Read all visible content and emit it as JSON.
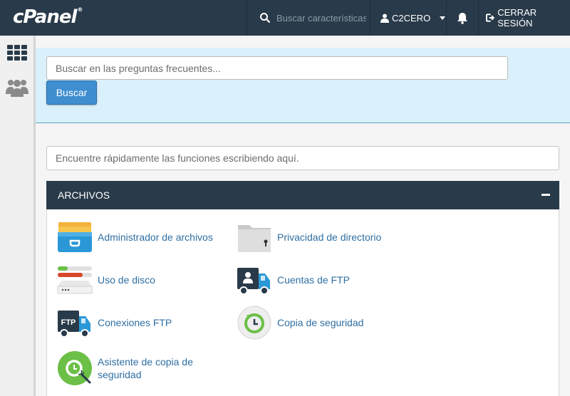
{
  "topbar": {
    "logo": "cPanel",
    "logo_mark": "®",
    "search_placeholder": "Buscar características",
    "user": "C2CERO",
    "logout": "CERRAR SESIÓN"
  },
  "faq": {
    "placeholder": "Buscar en las preguntas frecuentes...",
    "button": "Buscar"
  },
  "quick_find": {
    "placeholder": "Encuentre rápidamente las funciones escribiendo aquí."
  },
  "files_panel": {
    "title": "ARCHIVOS",
    "items": [
      {
        "label": "Administrador de archivos",
        "icon": "file-manager-icon"
      },
      {
        "label": "Privacidad de directorio",
        "icon": "directory-privacy-icon"
      },
      {
        "label": "Uso de disco",
        "icon": "disk-usage-icon"
      },
      {
        "label": "Cuentas de FTP",
        "icon": "ftp-accounts-icon"
      },
      {
        "label": "Conexiones FTP",
        "icon": "ftp-connections-icon"
      },
      {
        "label": "Copia de seguridad",
        "icon": "backup-icon"
      },
      {
        "label": "Asistente de copia de seguridad",
        "icon": "backup-wizard-icon"
      }
    ],
    "ftp_badge": "FTP"
  },
  "colors": {
    "topbar": "#293a4a",
    "link": "#2f6fa3",
    "button": "#3f8ed0",
    "faq_band": "#daf0fa"
  }
}
